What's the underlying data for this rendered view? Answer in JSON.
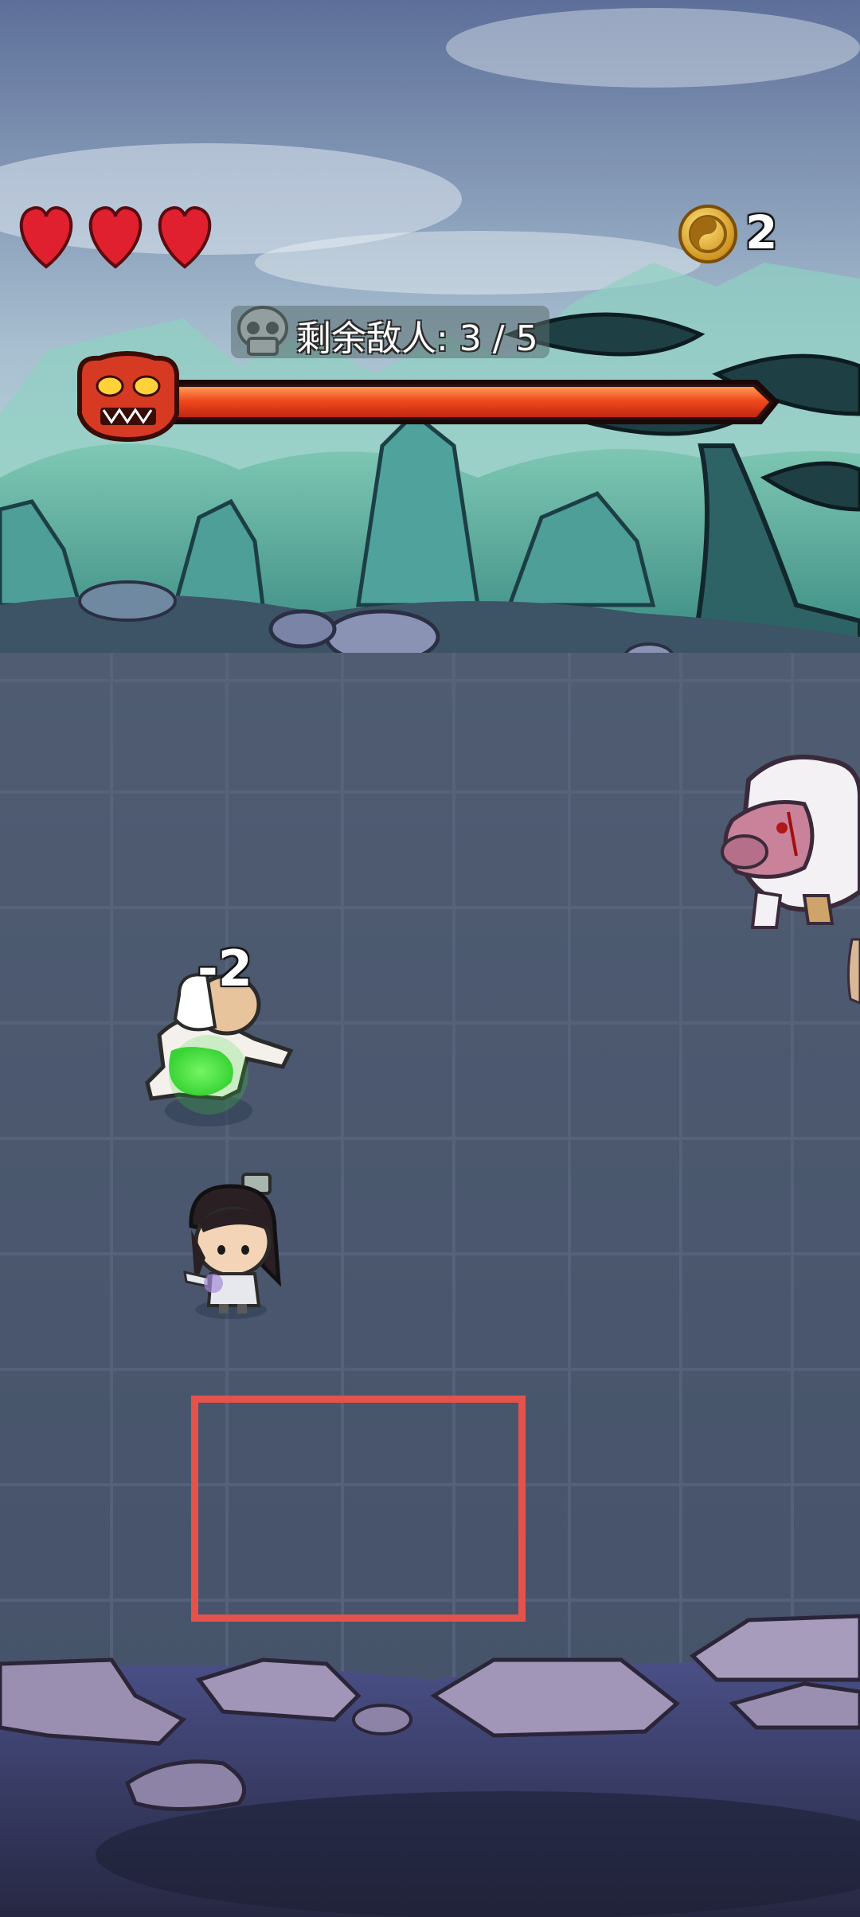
{
  "hud": {
    "hearts": 3,
    "heart_color": "#e0202e",
    "coin_icon": "yin-yang-coin-icon",
    "coin_count": "2",
    "enemies_label": "剩余敌人: 3 / 5",
    "enemies_remaining": 3,
    "enemies_total": 5,
    "boss_icon": "demon-mask-icon",
    "boss_health_fraction": 1.0,
    "boss_health_color": "#f04a1c"
  },
  "battlefield": {
    "damage_popup": "-2",
    "target_box_color": "#e5524c"
  }
}
